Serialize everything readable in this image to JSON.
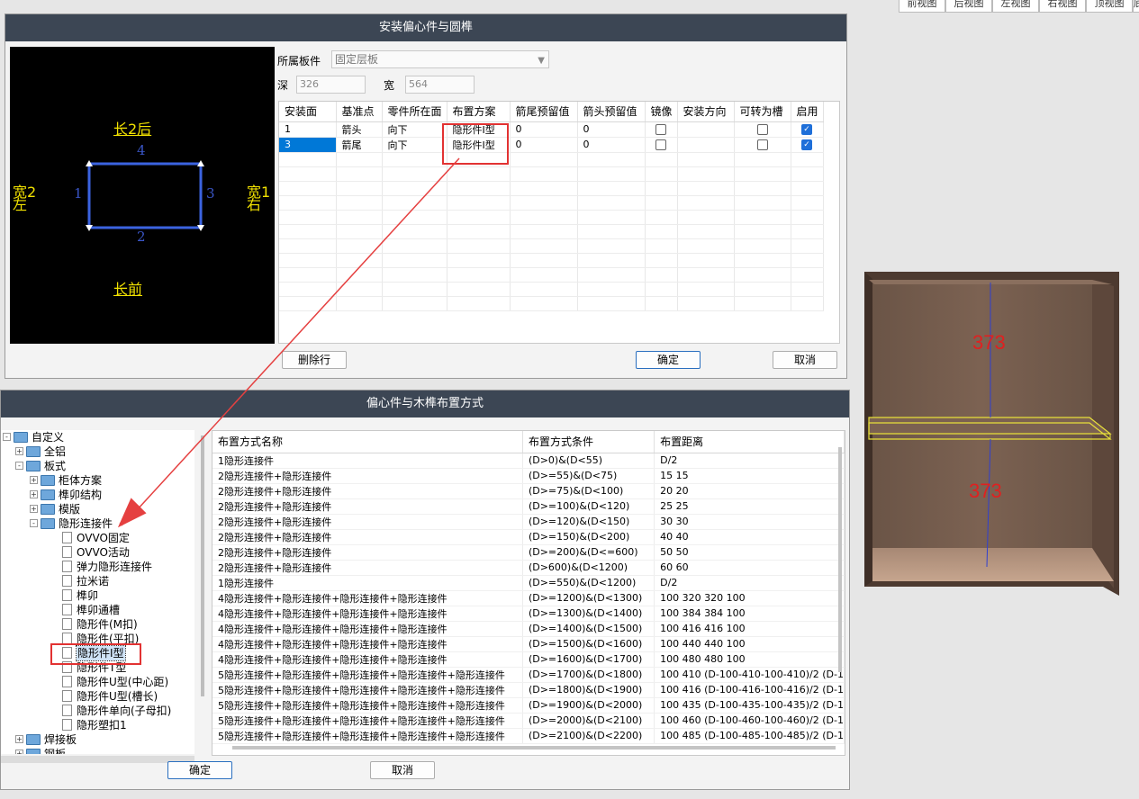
{
  "view_tabs": [
    "前视图",
    "后视图",
    "左视图",
    "右视图",
    "顶视图",
    "底"
  ],
  "dialog1": {
    "title": "安装偏心件与圆榫",
    "board_label": "所属板件",
    "board_value": "固定层板",
    "depth_label": "深",
    "depth_value": "326",
    "width_label": "宽",
    "width_value": "564",
    "preview": {
      "top_label": "长2后",
      "bottom_label": "长前",
      "left_label_1": "宽2",
      "left_label_2": "左",
      "right_label_1": "宽1",
      "right_label_2": "右",
      "edge_top": "4",
      "edge_bottom": "2",
      "edge_left": "1",
      "edge_right": "3"
    },
    "columns": [
      "安装面",
      "基准点",
      "零件所在面",
      "布置方案",
      "箭尾预留值",
      "箭头预留值",
      "镜像",
      "安装方向",
      "可转为槽",
      "启用"
    ],
    "rows": [
      {
        "face": "1",
        "ref": "箭头",
        "side": "向下",
        "plan": "隐形件I型",
        "tail": "0",
        "head": "0",
        "mirror": false,
        "dir": "",
        "slot": false,
        "enabled": true
      },
      {
        "face": "3",
        "ref": "箭尾",
        "side": "向下",
        "plan": "隐形件I型",
        "tail": "0",
        "head": "0",
        "mirror": false,
        "dir": "",
        "slot": false,
        "enabled": true
      }
    ],
    "delete_button": "删除行",
    "ok_button": "确定",
    "cancel_button": "取消"
  },
  "dialog2": {
    "title": "偏心件与木榫布置方式",
    "tree": [
      {
        "label": "自定义",
        "level": 0,
        "kind": "folder",
        "expander": "-"
      },
      {
        "label": "全铝",
        "level": 1,
        "kind": "folder",
        "expander": "+"
      },
      {
        "label": "板式",
        "level": 1,
        "kind": "folder",
        "expander": "-"
      },
      {
        "label": "柜体方案",
        "level": 2,
        "kind": "folder",
        "expander": "+"
      },
      {
        "label": "榫卯结构",
        "level": 2,
        "kind": "folder",
        "expander": "+"
      },
      {
        "label": "模版",
        "level": 2,
        "kind": "folder",
        "expander": "+"
      },
      {
        "label": "隐形连接件",
        "level": 2,
        "kind": "folder",
        "expander": "-"
      },
      {
        "label": "OVVO固定",
        "level": 3,
        "kind": "doc"
      },
      {
        "label": "OVVO活动",
        "level": 3,
        "kind": "doc"
      },
      {
        "label": "弹力隐形连接件",
        "level": 3,
        "kind": "doc"
      },
      {
        "label": "拉米诺",
        "level": 3,
        "kind": "doc"
      },
      {
        "label": "榫卯",
        "level": 3,
        "kind": "doc"
      },
      {
        "label": "榫卯通槽",
        "level": 3,
        "kind": "doc"
      },
      {
        "label": "隐形件(M扣)",
        "level": 3,
        "kind": "doc"
      },
      {
        "label": "隐形件(平扣)",
        "level": 3,
        "kind": "doc"
      },
      {
        "label": "隐形件I型",
        "level": 3,
        "kind": "doc",
        "selected": true
      },
      {
        "label": "隐形件T型",
        "level": 3,
        "kind": "doc"
      },
      {
        "label": "隐形件U型(中心距)",
        "level": 3,
        "kind": "doc"
      },
      {
        "label": "隐形件U型(槽长)",
        "level": 3,
        "kind": "doc"
      },
      {
        "label": "隐形件单向(子母扣)",
        "level": 3,
        "kind": "doc"
      },
      {
        "label": "隐形塑扣1",
        "level": 3,
        "kind": "doc"
      },
      {
        "label": "焊接板",
        "level": 1,
        "kind": "folder",
        "expander": "+"
      },
      {
        "label": "钢板",
        "level": 1,
        "kind": "folder",
        "expander": "+"
      }
    ],
    "columns": [
      "布置方式名称",
      "布置方式条件",
      "布置距离"
    ],
    "rows": [
      [
        "1隐形连接件",
        "(D>0)&(D<55)",
        "D/2"
      ],
      [
        "2隐形连接件+隐形连接件",
        "(D>=55)&(D<75)",
        "15 15"
      ],
      [
        "2隐形连接件+隐形连接件",
        "(D>=75)&(D<100)",
        "20 20"
      ],
      [
        "2隐形连接件+隐形连接件",
        "(D>=100)&(D<120)",
        "25 25"
      ],
      [
        "2隐形连接件+隐形连接件",
        "(D>=120)&(D<150)",
        "30 30"
      ],
      [
        "2隐形连接件+隐形连接件",
        "(D>=150)&(D<200)",
        "40 40"
      ],
      [
        "2隐形连接件+隐形连接件",
        "(D>=200)&(D<=600)",
        "50 50"
      ],
      [
        "2隐形连接件+隐形连接件",
        "(D>600)&(D<1200)",
        "60 60"
      ],
      [
        "1隐形连接件",
        "(D>=550)&(D<1200)",
        "D/2"
      ],
      [
        "4隐形连接件+隐形连接件+隐形连接件+隐形连接件",
        "(D>=1200)&(D<1300)",
        "100 320 320 100"
      ],
      [
        "4隐形连接件+隐形连接件+隐形连接件+隐形连接件",
        "(D>=1300)&(D<1400)",
        "100 384 384 100"
      ],
      [
        "4隐形连接件+隐形连接件+隐形连接件+隐形连接件",
        "(D>=1400)&(D<1500)",
        "100 416 416 100"
      ],
      [
        "4隐形连接件+隐形连接件+隐形连接件+隐形连接件",
        "(D>=1500)&(D<1600)",
        "100 440 440 100"
      ],
      [
        "4隐形连接件+隐形连接件+隐形连接件+隐形连接件",
        "(D>=1600)&(D<1700)",
        "100 480 480 100"
      ],
      [
        "5隐形连接件+隐形连接件+隐形连接件+隐形连接件+隐形连接件",
        "(D>=1700)&(D<1800)",
        "100 410 (D-100-410-100-410)/2 (D-1"
      ],
      [
        "5隐形连接件+隐形连接件+隐形连接件+隐形连接件+隐形连接件",
        "(D>=1800)&(D<1900)",
        "100 416 (D-100-416-100-416)/2 (D-1"
      ],
      [
        "5隐形连接件+隐形连接件+隐形连接件+隐形连接件+隐形连接件",
        "(D>=1900)&(D<2000)",
        "100 435 (D-100-435-100-435)/2 (D-1"
      ],
      [
        "5隐形连接件+隐形连接件+隐形连接件+隐形连接件+隐形连接件",
        "(D>=2000)&(D<2100)",
        "100 460 (D-100-460-100-460)/2 (D-1"
      ],
      [
        "5隐形连接件+隐形连接件+隐形连接件+隐形连接件+隐形连接件",
        "(D>=2100)&(D<2200)",
        "100 485 (D-100-485-100-485)/2 (D-1"
      ]
    ],
    "ok_button": "确定",
    "cancel_button": "取消"
  },
  "cabinet": {
    "upper_dimension": "373",
    "lower_dimension": "373"
  },
  "colors": {
    "titlebar": "#3c4654",
    "highlight_red": "#e23232",
    "selection_blue": "#0078d7",
    "label_yellow": "#f2e200",
    "edge_blue": "#3a56c8"
  }
}
